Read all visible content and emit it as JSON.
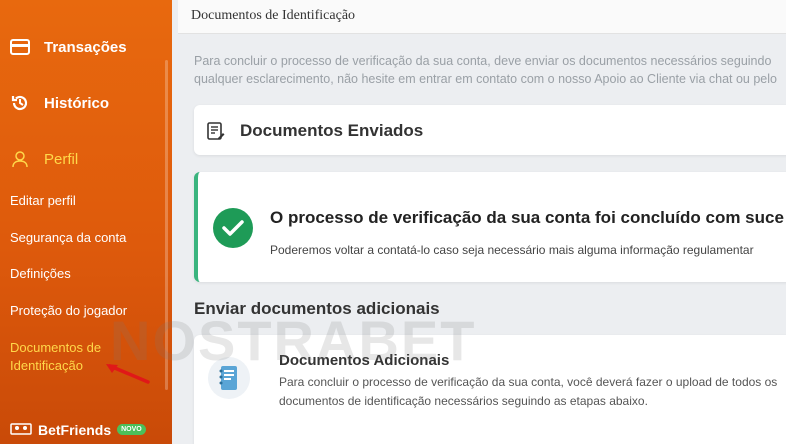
{
  "sidebar": {
    "nav": [
      {
        "label": "Transações",
        "icon": "card-icon"
      },
      {
        "label": "Histórico",
        "icon": "history-icon"
      },
      {
        "label": "Perfil",
        "icon": "user-icon"
      }
    ],
    "sub_items": [
      {
        "label": "Editar perfil"
      },
      {
        "label": "Segurança da conta"
      },
      {
        "label": "Definições"
      },
      {
        "label": "Proteção do jogador"
      },
      {
        "label": "Documentos de Identificação"
      }
    ],
    "betfriends": {
      "label": "BetFriends",
      "badge": "NOVO"
    }
  },
  "header": {
    "title": "Documentos de Identificação"
  },
  "intro": {
    "line1": "Para concluir o processo de verificação da sua conta, deve enviar os documentos necessários seguindo",
    "line2": "qualquer esclarecimento, não hesite em entrar em contato com o nosso Apoio ao Cliente via chat ou pelo"
  },
  "sent_card": {
    "label": "Documentos Enviados",
    "icon": "document-edit-icon"
  },
  "status_card": {
    "headline": "O processo de verificação da sua conta foi concluído com suce",
    "sub": "Poderemos voltar a contatá-lo caso seja necessário mais alguma informação regulamentar",
    "icon": "check-circle-icon",
    "accent": "#3ab47e"
  },
  "section": {
    "title": "Enviar documentos adicionais"
  },
  "extra_card": {
    "title": "Documentos Adicionais",
    "desc": "Para concluir o processo de verificação da sua conta, você deverá fazer o upload de todos os documentos de identificação necessários seguindo as etapas abaixo.",
    "icon": "notebook-icon"
  },
  "watermark": "NOSTRABET",
  "colors": {
    "sidebar": "#e0600d",
    "active": "#ffd84a",
    "success": "#1e9b57"
  }
}
